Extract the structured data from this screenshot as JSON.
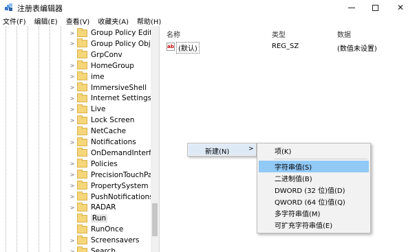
{
  "window": {
    "title": "注册表编辑器"
  },
  "menubar": {
    "items": [
      "文件(F)",
      "编辑(E)",
      "查看(V)",
      "收藏夹(A)",
      "帮助(H)"
    ]
  },
  "tree": {
    "items": [
      {
        "label": "Group Policy Editor",
        "expandable": true,
        "selected": false
      },
      {
        "label": "Group Policy Objec",
        "expandable": true,
        "selected": false
      },
      {
        "label": "GrpConv",
        "expandable": false,
        "selected": false
      },
      {
        "label": "HomeGroup",
        "expandable": true,
        "selected": false
      },
      {
        "label": "ime",
        "expandable": true,
        "selected": false
      },
      {
        "label": "ImmersiveShell",
        "expandable": true,
        "selected": false
      },
      {
        "label": "Internet Settings",
        "expandable": true,
        "selected": false
      },
      {
        "label": "Live",
        "expandable": true,
        "selected": false
      },
      {
        "label": "Lock Screen",
        "expandable": true,
        "selected": false
      },
      {
        "label": "NetCache",
        "expandable": false,
        "selected": false
      },
      {
        "label": "Notifications",
        "expandable": true,
        "selected": false
      },
      {
        "label": "OnDemandInterface",
        "expandable": false,
        "selected": false
      },
      {
        "label": "Policies",
        "expandable": true,
        "selected": false
      },
      {
        "label": "PrecisionTouchPad",
        "expandable": true,
        "selected": false
      },
      {
        "label": "PropertySystem",
        "expandable": true,
        "selected": false
      },
      {
        "label": "PushNotifications",
        "expandable": true,
        "selected": false
      },
      {
        "label": "RADAR",
        "expandable": true,
        "selected": false
      },
      {
        "label": "Run",
        "expandable": false,
        "selected": true
      },
      {
        "label": "RunOnce",
        "expandable": false,
        "selected": false
      },
      {
        "label": "Screensavers",
        "expandable": true,
        "selected": false
      },
      {
        "label": "Search",
        "expandable": true,
        "selected": false
      }
    ]
  },
  "list": {
    "headers": {
      "name": "名称",
      "type": "类型",
      "data": "数据"
    },
    "rows": [
      {
        "icon": "string-value-icon",
        "icon_text": "ab",
        "name": "(默认)",
        "type": "REG_SZ",
        "data": "(数值未设置)"
      }
    ]
  },
  "context_menu": {
    "new_label": "新建(N)",
    "submenu_arrow": ">",
    "submenu": [
      {
        "label": "项(K)",
        "highlighted": false
      },
      {
        "label": "字符串值(S)",
        "highlighted": true
      },
      {
        "label": "二进制值(B)",
        "highlighted": false
      },
      {
        "label": "DWORD (32 位)值(D)",
        "highlighted": false
      },
      {
        "label": "QWORD (64 位)值(Q)",
        "highlighted": false
      },
      {
        "label": "多字符串值(M)",
        "highlighted": false
      },
      {
        "label": "可扩充字符串值(E)",
        "highlighted": false
      }
    ]
  },
  "colors": {
    "folder": "#f5d67a",
    "highlight": "#91c9f7",
    "menu_bg": "#f2f2f2"
  }
}
